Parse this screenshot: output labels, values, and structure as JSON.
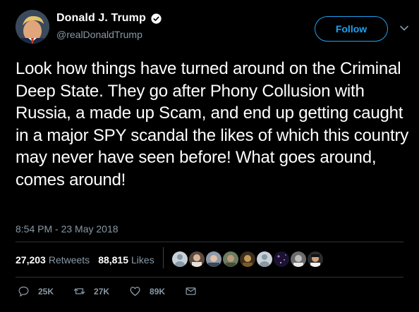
{
  "author": {
    "display_name": "Donald J. Trump",
    "handle": "@realDonaldTrump",
    "verified": true
  },
  "follow_button": {
    "label": "Follow"
  },
  "tweet": {
    "text": "Look how things have turned around on the Criminal Deep State. They go after Phony Collusion with Russia, a made up Scam, and end up getting caught in a major SPY scandal the likes of which this country may never have seen before! What goes around, comes around!",
    "timestamp": "8:54 PM - 23 May 2018"
  },
  "stats": {
    "retweets_count": "27,203",
    "retweets_label": "Retweets",
    "likes_count": "88,815",
    "likes_label": "Likes"
  },
  "actions": {
    "reply_count": "25K",
    "retweet_count": "27K",
    "like_count": "89K"
  },
  "colors": {
    "background": "#000000",
    "accent": "#1da1f2",
    "muted": "#8899a6",
    "divider": "#2f3336"
  },
  "icons": [
    "verified-badge-icon",
    "chevron-down-icon",
    "reply-icon",
    "retweet-icon",
    "heart-icon",
    "message-icon"
  ]
}
